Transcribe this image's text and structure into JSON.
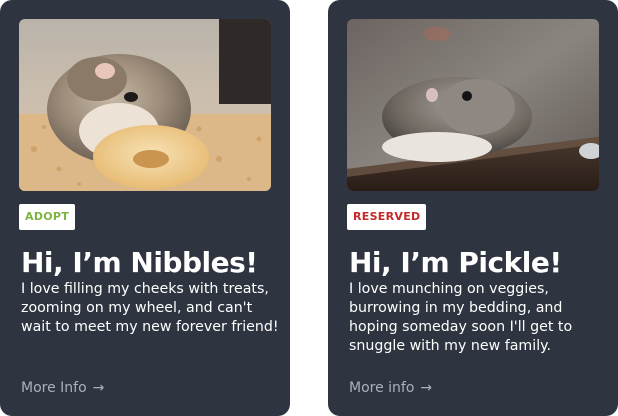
{
  "colors": {
    "card_background": "#2e3440",
    "adopt_badge": "#7cb342",
    "reserved_badge": "#c62828",
    "link": "#aab1be"
  },
  "cards": [
    {
      "image_icon": "hamster-eating-photo",
      "badge": "ADOPT",
      "title": "Hi, I’m Nibbles!",
      "description": "I love filling my cheeks with treats, zooming on my wheel, and can't wait to meet my new forever friend!",
      "link": "More Info",
      "link_icon": "arrow-right-icon"
    },
    {
      "image_icon": "hamster-on-table-photo",
      "badge": "RESERVED",
      "title": "Hi, I’m Pickle!",
      "description": "I love munching on veggies, burrowing in my bedding, and hoping someday soon I'll get to snuggle with my new family.",
      "link": "More info",
      "link_icon": "arrow-right-icon"
    }
  ]
}
